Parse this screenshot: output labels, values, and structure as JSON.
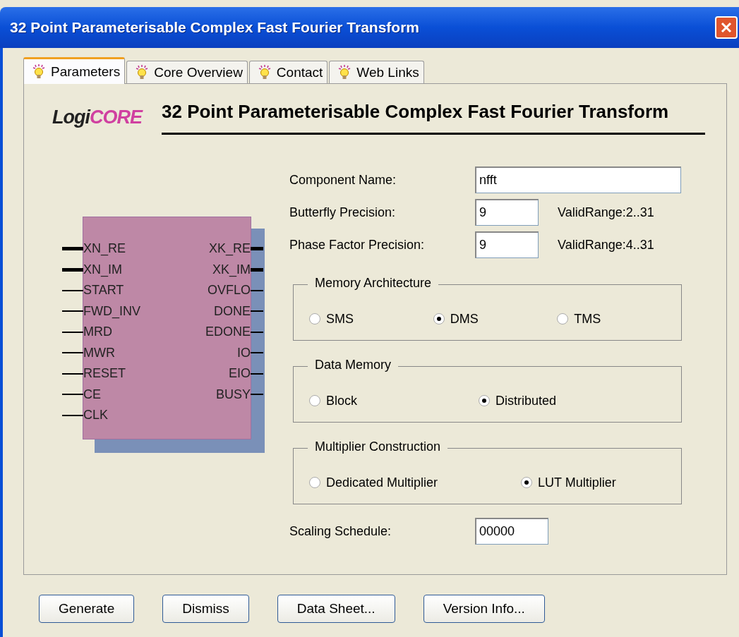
{
  "window": {
    "title": "32 Point Parameterisable Complex Fast Fourier Transform"
  },
  "tabs": [
    {
      "label": "Parameters",
      "selected": true
    },
    {
      "label": "Core Overview",
      "selected": false
    },
    {
      "label": "Contact",
      "selected": false
    },
    {
      "label": "Web Links",
      "selected": false
    }
  ],
  "logo": {
    "prefix": "Logi",
    "suffix": "CORE"
  },
  "heading": "32 Point Parameterisable Complex Fast Fourier Transform",
  "symbol": {
    "inputs": [
      {
        "name": "XN_RE",
        "bus": true
      },
      {
        "name": "XN_IM",
        "bus": true
      },
      {
        "name": "START",
        "bus": false
      },
      {
        "name": "FWD_INV",
        "bus": false
      },
      {
        "name": "MRD",
        "bus": false
      },
      {
        "name": "MWR",
        "bus": false
      },
      {
        "name": "RESET",
        "bus": false
      },
      {
        "name": "CE",
        "bus": false
      },
      {
        "name": "CLK",
        "bus": false
      }
    ],
    "outputs": [
      {
        "name": "XK_RE",
        "bus": true
      },
      {
        "name": "XK_IM",
        "bus": true
      },
      {
        "name": "OVFLO",
        "bus": false
      },
      {
        "name": "DONE",
        "bus": false
      },
      {
        "name": "EDONE",
        "bus": false
      },
      {
        "name": "IO",
        "bus": false
      },
      {
        "name": "EIO",
        "bus": false
      },
      {
        "name": "BUSY",
        "bus": false
      }
    ]
  },
  "fields": [
    {
      "label": "Component Name:",
      "value": "nfft"
    },
    {
      "label": "Butterfly Precision:",
      "value": "9",
      "hint": "ValidRange:2..31"
    },
    {
      "label": "Phase Factor Precision:",
      "value": "9",
      "hint": "ValidRange:4..31"
    }
  ],
  "groups": [
    {
      "title": "Memory Architecture",
      "options": [
        {
          "label": "SMS",
          "selected": false
        },
        {
          "label": "DMS",
          "selected": true
        },
        {
          "label": "TMS",
          "selected": false
        }
      ]
    },
    {
      "title": "Data Memory",
      "options": [
        {
          "label": "Block",
          "selected": false
        },
        {
          "label": "Distributed",
          "selected": true
        }
      ]
    },
    {
      "title": "Multiplier Construction",
      "options": [
        {
          "label": "Dedicated Multiplier",
          "selected": false
        },
        {
          "label": "LUT Multiplier",
          "selected": true
        }
      ]
    }
  ],
  "scaling": {
    "label": "Scaling Schedule:",
    "value": "00000"
  },
  "buttons": [
    "Generate",
    "Dismiss",
    "Data Sheet...",
    "Version Info..."
  ]
}
